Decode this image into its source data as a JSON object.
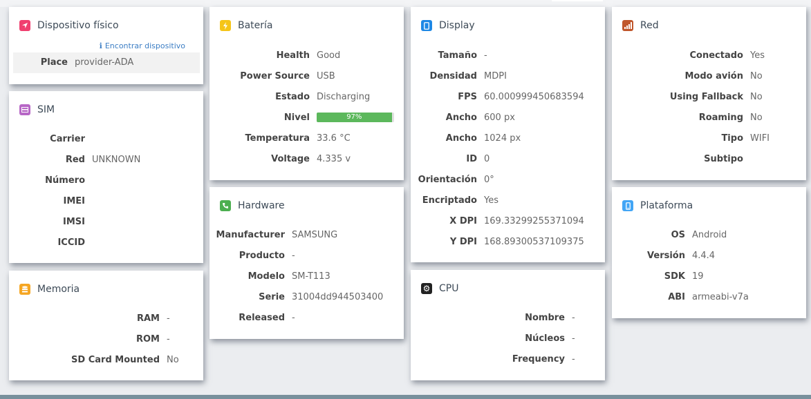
{
  "colors": {
    "dispositivo": "#f03f6f",
    "sim": "#b767c6",
    "memoria": "#f5a623",
    "bateria": "#f5c518",
    "hardware": "#4caf50",
    "display": "#1e88e5",
    "cpu": "#222222",
    "red": "#c0562b",
    "plataforma": "#42a5f5",
    "battery_bar": "#5cb85c"
  },
  "dispositivo": {
    "title": "Dispositivo físico",
    "icon": "location-arrow-icon",
    "find_link": "Encontrar dispositivo",
    "find_icon": "info-icon",
    "place_label": "Place",
    "place_value": "provider-ADA"
  },
  "sim": {
    "title": "SIM",
    "icon": "sim-card-icon",
    "rows": [
      {
        "label": "Carrier",
        "value": ""
      },
      {
        "label": "Red",
        "value": "UNKNOWN"
      },
      {
        "label": "Número",
        "value": ""
      },
      {
        "label": "IMEI",
        "value": ""
      },
      {
        "label": "IMSI",
        "value": ""
      },
      {
        "label": "ICCID",
        "value": ""
      }
    ]
  },
  "memoria": {
    "title": "Memoria",
    "icon": "database-icon",
    "rows": [
      {
        "label": "RAM",
        "value": "-"
      },
      {
        "label": "ROM",
        "value": "-"
      },
      {
        "label": "SD Card Mounted",
        "value": "No"
      }
    ]
  },
  "bateria": {
    "title": "Batería",
    "icon": "bolt-icon",
    "rows": [
      {
        "label": "Health",
        "value": "Good"
      },
      {
        "label": "Power Source",
        "value": "USB"
      },
      {
        "label": "Estado",
        "value": "Discharging"
      }
    ],
    "nivel_label": "Nivel",
    "nivel_value": "97%",
    "nivel_fraction": 0.97,
    "rows2": [
      {
        "label": "Temperatura",
        "value": "33.6 °C"
      },
      {
        "label": "Voltage",
        "value": "4.335 v"
      }
    ]
  },
  "hardware": {
    "title": "Hardware",
    "icon": "phone-icon",
    "rows": [
      {
        "label": "Manufacturer",
        "value": "SAMSUNG"
      },
      {
        "label": "Producto",
        "value": "-"
      },
      {
        "label": "Modelo",
        "value": "SM-T113"
      },
      {
        "label": "Serie",
        "value": "31004dd944503400"
      },
      {
        "label": "Released",
        "value": "-"
      }
    ]
  },
  "display": {
    "title": "Display",
    "icon": "tablet-icon",
    "rows": [
      {
        "label": "Tamaño",
        "value": "-"
      },
      {
        "label": "Densidad",
        "value": "MDPI"
      },
      {
        "label": "FPS",
        "value": "60.000999450683594"
      },
      {
        "label": "Ancho",
        "value": "600 px"
      },
      {
        "label": "Ancho",
        "value": "1024 px"
      },
      {
        "label": "ID",
        "value": "0"
      },
      {
        "label": "Orientación",
        "value": "0°"
      },
      {
        "label": "Encriptado",
        "value": "Yes"
      },
      {
        "label": "X DPI",
        "value": "169.33299255371094"
      },
      {
        "label": "Y DPI",
        "value": "168.89300537109375"
      }
    ]
  },
  "cpu": {
    "title": "CPU",
    "icon": "cog-icon",
    "rows": [
      {
        "label": "Nombre",
        "value": "-"
      },
      {
        "label": "Núcleos",
        "value": "-"
      },
      {
        "label": "Frequency",
        "value": "-"
      }
    ]
  },
  "red": {
    "title": "Red",
    "icon": "signal-icon",
    "rows": [
      {
        "label": "Conectado",
        "value": "Yes"
      },
      {
        "label": "Modo avión",
        "value": "No"
      },
      {
        "label": "Using Fallback",
        "value": "No"
      },
      {
        "label": "Roaming",
        "value": "No"
      },
      {
        "label": "Tipo",
        "value": "WIFI"
      },
      {
        "label": "Subtipo",
        "value": ""
      }
    ]
  },
  "plataforma": {
    "title": "Plataforma",
    "icon": "mobile-icon",
    "rows": [
      {
        "label": "OS",
        "value": "Android"
      },
      {
        "label": "Versión",
        "value": "4.4.4"
      },
      {
        "label": "SDK",
        "value": "19"
      },
      {
        "label": "ABI",
        "value": "armeabi-v7a"
      }
    ]
  }
}
